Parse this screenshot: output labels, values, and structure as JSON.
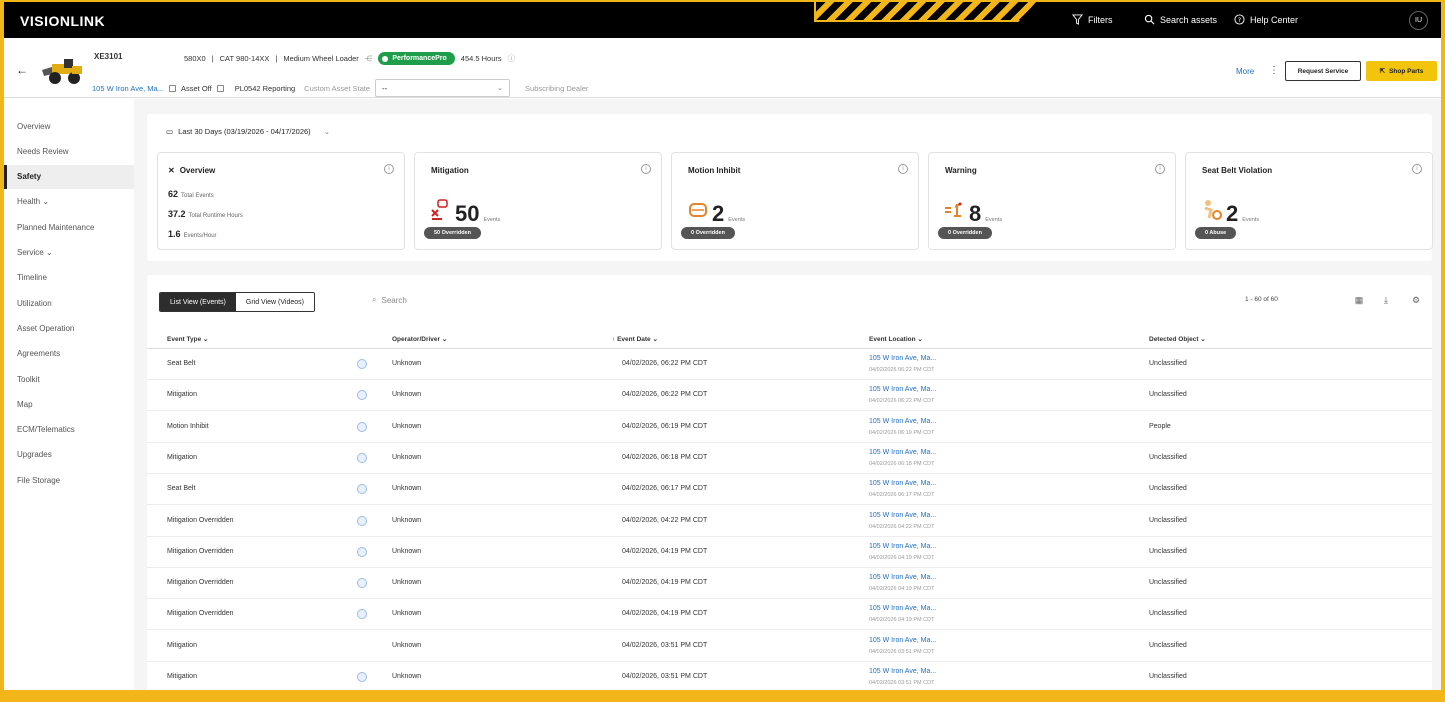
{
  "topbar": {
    "logo": "VISIONLINK",
    "filters_label": "Filters",
    "search_label": "Search assets",
    "help_label": "Help Center",
    "user_initials": "IU"
  },
  "asset": {
    "id": "XE3101",
    "serial": "580X0",
    "model": "CAT 980-14XX",
    "type": "Medium Wheel Loader",
    "subscription": "PerformancePro",
    "hours": "454.5 Hours",
    "location": "105 W Iron Ave, Ma...",
    "asset_off": "Asset Off",
    "reporting": "PL0542 Reporting",
    "custom_state_label": "Custom Asset State",
    "custom_state_value": "--",
    "dealer_label": "Subscribing Dealer",
    "more_label": "More",
    "request_service": "Request Service",
    "shop_parts": "Shop Parts"
  },
  "sidebar": {
    "items": [
      {
        "label": "Overview"
      },
      {
        "label": "Needs Review"
      },
      {
        "label": "Safety"
      },
      {
        "label": "Health ⌄"
      },
      {
        "label": "Planned Maintenance"
      },
      {
        "label": "Service ⌄"
      },
      {
        "label": "Timeline"
      },
      {
        "label": "Utilization"
      },
      {
        "label": "Asset Operation"
      },
      {
        "label": "Agreements"
      },
      {
        "label": "Toolkit"
      },
      {
        "label": "Map"
      },
      {
        "label": "ECM/Telematics"
      },
      {
        "label": "Upgrades"
      },
      {
        "label": "File Storage"
      }
    ],
    "active_index": 2
  },
  "summary": {
    "date_range": "Last 30 Days (03/19/2026 - 04/17/2026)",
    "overview": {
      "title": "Overview",
      "rows": [
        {
          "value": "62",
          "label": "Total Events"
        },
        {
          "value": "37.2",
          "label": "Total Runtime Hours"
        },
        {
          "value": "1.6",
          "label": "Events/Hour"
        }
      ]
    },
    "cards": [
      {
        "title": "Mitigation",
        "value": "50",
        "unit": "Events",
        "pill": "50 Overridden",
        "icon": "mitigation-icon"
      },
      {
        "title": "Motion Inhibit",
        "value": "2",
        "unit": "Events",
        "pill": "0 Overridden",
        "icon": "motion-inhibit-icon"
      },
      {
        "title": "Warning",
        "value": "8",
        "unit": "Events",
        "pill": "0 Overridden",
        "icon": "warning-icon"
      },
      {
        "title": "Seat Belt Violation",
        "value": "2",
        "unit": "Events",
        "pill": "0 Abuse",
        "icon": "seat-belt-icon"
      }
    ]
  },
  "events": {
    "list_view": "List View (Events)",
    "grid_view": "Grid View (Videos)",
    "search_placeholder": "Search",
    "pager": "1 - 60 of 60",
    "columns": [
      "Event Type",
      "Operator/Driver",
      "Event Date",
      "Event Location",
      "Detected Object"
    ],
    "rows": [
      {
        "type": "Seat Belt",
        "operator": "Unknown",
        "date": "04/02/2026, 06:22 PM CDT",
        "loc": "105 W Iron Ave, Ma...",
        "loc_time": "04/02/2026 06:22 PM CDT",
        "object": "Unclassified",
        "video": true
      },
      {
        "type": "Mitigation",
        "operator": "Unknown",
        "date": "04/02/2026, 06:22 PM CDT",
        "loc": "105 W Iron Ave, Ma...",
        "loc_time": "04/02/2026 06:22 PM CDT",
        "object": "Unclassified",
        "video": true
      },
      {
        "type": "Motion Inhibit",
        "operator": "Unknown",
        "date": "04/02/2026, 06:19 PM CDT",
        "loc": "105 W Iron Ave, Ma...",
        "loc_time": "04/02/2026 06:19 PM CDT",
        "object": "People",
        "video": true
      },
      {
        "type": "Mitigation",
        "operator": "Unknown",
        "date": "04/02/2026, 06:18 PM CDT",
        "loc": "105 W Iron Ave, Ma...",
        "loc_time": "04/02/2026 06:18 PM CDT",
        "object": "Unclassified",
        "video": true
      },
      {
        "type": "Seat Belt",
        "operator": "Unknown",
        "date": "04/02/2026, 06:17 PM CDT",
        "loc": "105 W Iron Ave, Ma...",
        "loc_time": "04/02/2026 06:17 PM CDT",
        "object": "Unclassified",
        "video": true
      },
      {
        "type": "Mitigation Overridden",
        "operator": "Unknown",
        "date": "04/02/2026, 04:22 PM CDT",
        "loc": "105 W Iron Ave, Ma...",
        "loc_time": "04/02/2026 04:22 PM CDT",
        "object": "Unclassified",
        "video": true
      },
      {
        "type": "Mitigation Overridden",
        "operator": "Unknown",
        "date": "04/02/2026, 04:19 PM CDT",
        "loc": "105 W Iron Ave, Ma...",
        "loc_time": "04/02/2026 04:19 PM CDT",
        "object": "Unclassified",
        "video": true
      },
      {
        "type": "Mitigation Overridden",
        "operator": "Unknown",
        "date": "04/02/2026, 04:19 PM CDT",
        "loc": "105 W Iron Ave, Ma...",
        "loc_time": "04/02/2026 04:19 PM CDT",
        "object": "Unclassified",
        "video": true
      },
      {
        "type": "Mitigation Overridden",
        "operator": "Unknown",
        "date": "04/02/2026, 04:19 PM CDT",
        "loc": "105 W Iron Ave, Ma...",
        "loc_time": "04/02/2026 04:19 PM CDT",
        "object": "Unclassified",
        "video": true
      },
      {
        "type": "Mitigation",
        "operator": "Unknown",
        "date": "04/02/2026, 03:51 PM CDT",
        "loc": "105 W Iron Ave, Ma...",
        "loc_time": "04/02/2026 03:51 PM CDT",
        "object": "Unclassified",
        "video": false
      },
      {
        "type": "Mitigation",
        "operator": "Unknown",
        "date": "04/02/2026, 03:51 PM CDT",
        "loc": "105 W Iron Ave, Ma...",
        "loc_time": "04/02/2026 03:51 PM CDT",
        "object": "Unclassified",
        "video": true
      }
    ]
  },
  "colors": {
    "brand_yellow": "#f2b619",
    "link_blue": "#1f6fc4",
    "subscription_green": "#1e9e4a"
  }
}
